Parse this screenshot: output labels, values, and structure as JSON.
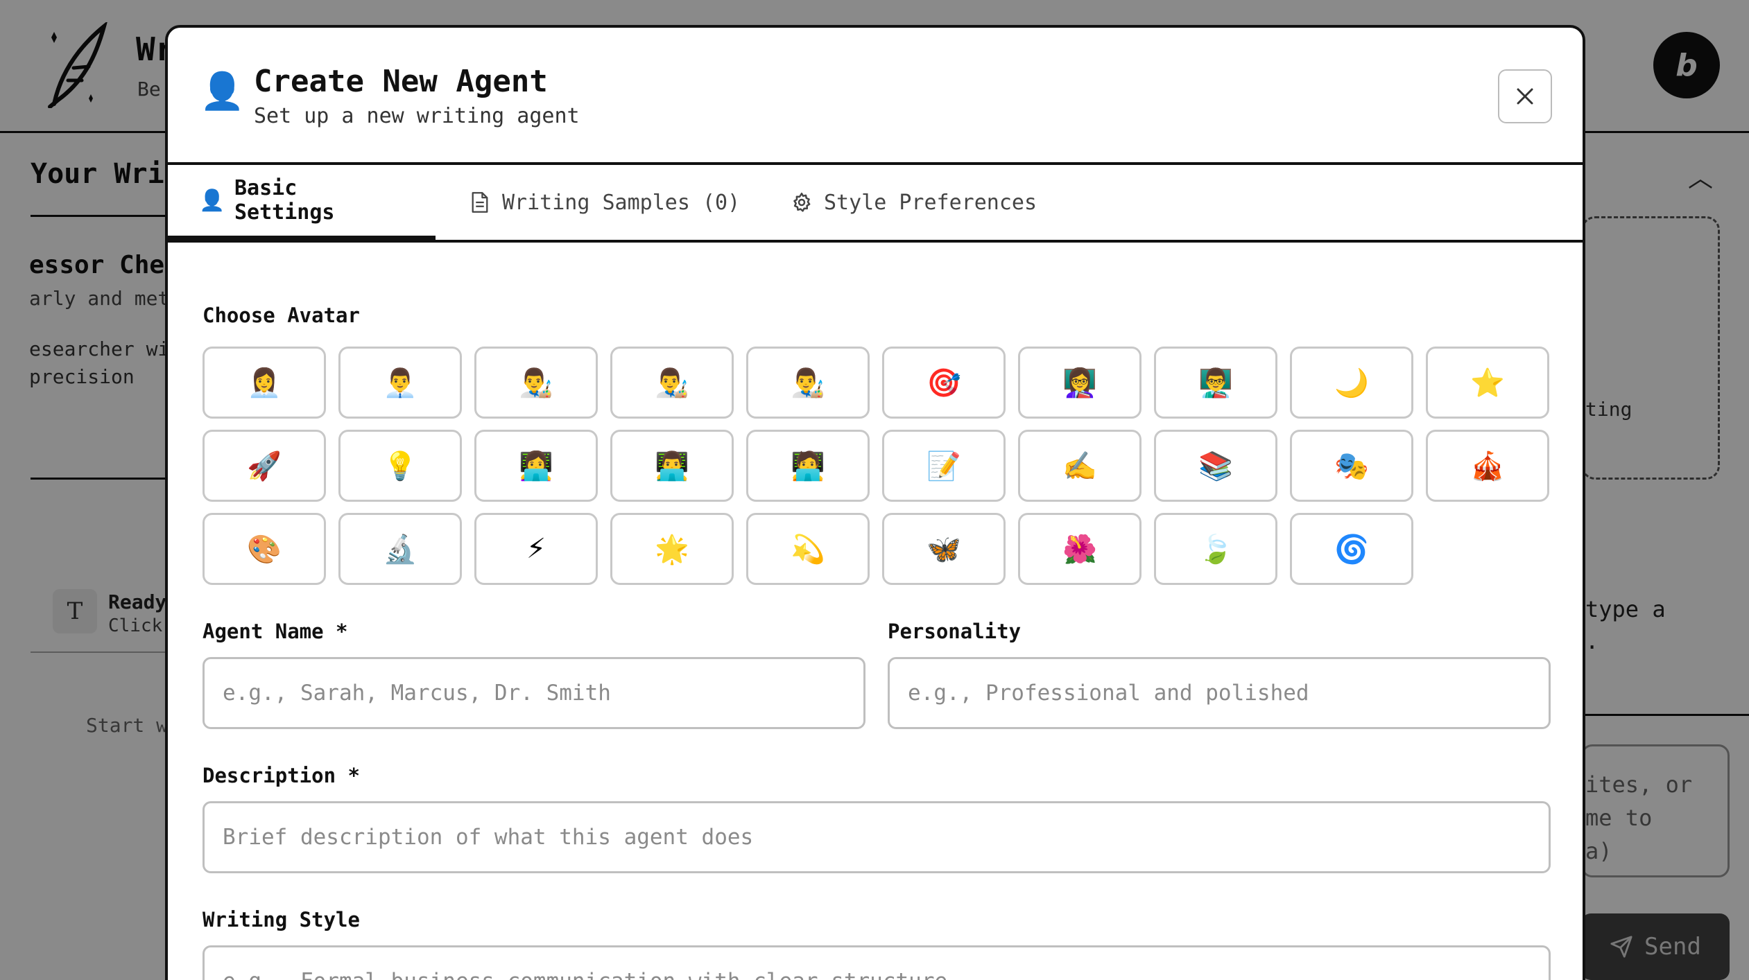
{
  "background": {
    "app_title": "Wr",
    "app_subtitle": "Be",
    "bolt_badge": "b",
    "section_title": "Your Wri",
    "agent_name": "essor Che",
    "agent_trait": "arly and met",
    "agent_desc": "esearcher wi\nprecision",
    "dashed_text": "ting",
    "ready_title": "Ready",
    "ready_sub": "Click",
    "ready_icon": "T",
    "start_text": "Start w",
    "right_text": "type a\n.",
    "textarea_text": "ites, or\nme to\na)",
    "send_label": "Send"
  },
  "modal": {
    "title": "Create New Agent",
    "subtitle": "Set up a new writing agent",
    "header_icon": "👤",
    "tabs": [
      {
        "label": "Basic Settings",
        "icon": "👤",
        "active": true
      },
      {
        "label": "Writing Samples (0)",
        "icon": "document-icon",
        "active": false
      },
      {
        "label": "Style Preferences",
        "icon": "gear-icon",
        "active": false
      }
    ],
    "choose_avatar_label": "Choose Avatar",
    "avatars": [
      "👩‍💼",
      "👨‍💼",
      "👨‍🎨",
      "👨‍🎨",
      "👨‍🎨",
      "🎯",
      "👩‍🏫",
      "👨‍🏫",
      "🌙",
      "⭐",
      "🚀",
      "💡",
      "👩‍💻",
      "👨‍💻",
      "🧑‍💻",
      "📝",
      "✍️",
      "📚",
      "🎭",
      "🎪",
      "🎨",
      "🔬",
      "⚡",
      "🌟",
      "💫",
      "🦋",
      "🌺",
      "🍃",
      "🌀"
    ],
    "agent_name": {
      "label": "Agent Name *",
      "placeholder": "e.g., Sarah, Marcus, Dr. Smith",
      "value": ""
    },
    "personality": {
      "label": "Personality",
      "placeholder": "e.g., Professional and polished",
      "value": ""
    },
    "description": {
      "label": "Description *",
      "placeholder": "Brief description of what this agent does",
      "value": ""
    },
    "writing_style": {
      "label": "Writing Style",
      "placeholder": "e.g., Formal business communication with clear structure",
      "value": ""
    }
  }
}
